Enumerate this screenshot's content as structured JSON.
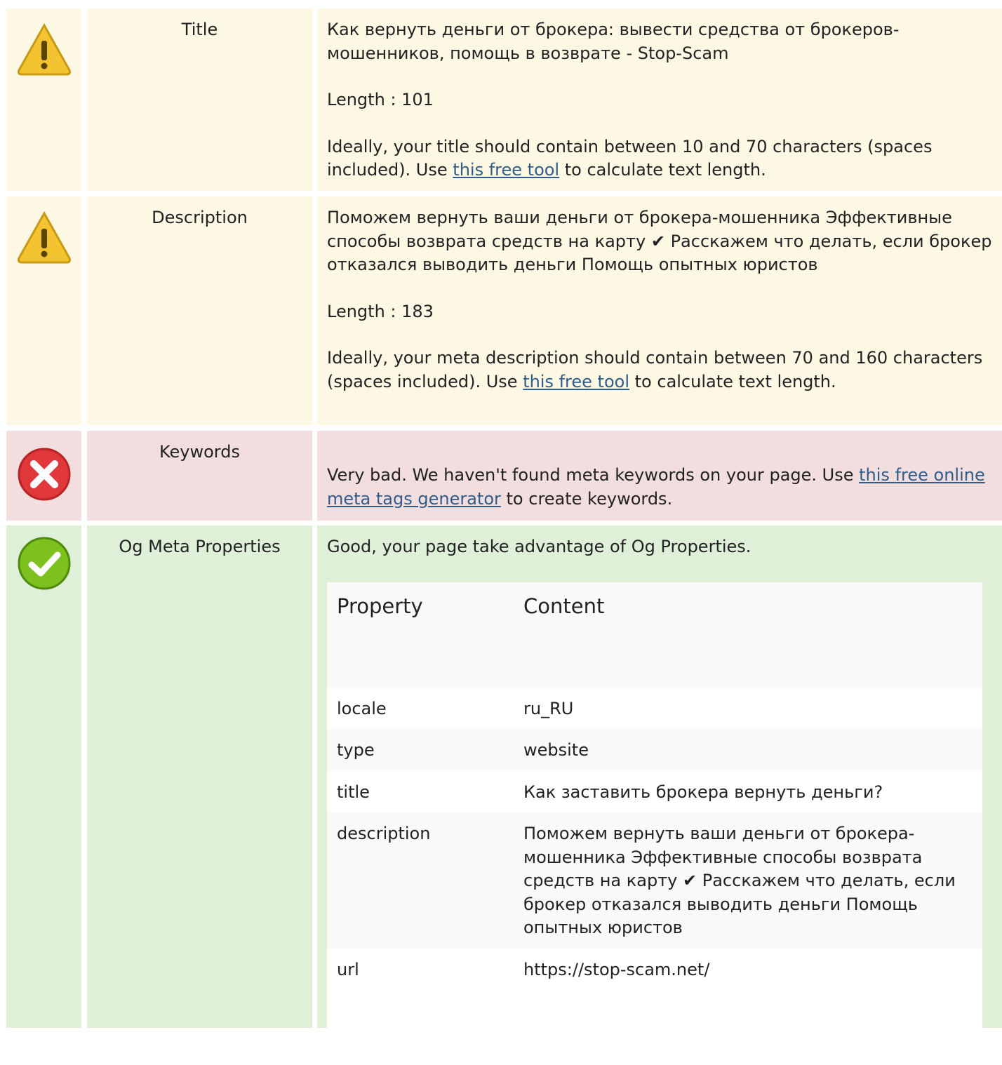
{
  "rows": {
    "title": {
      "label": "Title",
      "status": "warning",
      "text": "Как вернуть деньги от брокера: вывести средства от брокеров-мошенников, помощь в возврате - Stop-Scam",
      "length": "Length : 101",
      "advice_before": "Ideally, your title should contain between 10 and 70 characters (spaces included). Use ",
      "link": "this free tool",
      "advice_after": " to calculate text length."
    },
    "description": {
      "label": "Description",
      "status": "warning",
      "text": "Поможем вернуть ваши деньги от брокера-мошенника  Эффективные способы возврата средств на карту ✔ Расскажем что делать, если брокер отказался выводить деньги  Помощь опытных юристов",
      "length": "Length : 183",
      "advice_before": "Ideally, your meta description should contain between 70 and 160 characters (spaces included). Use ",
      "link": "this free tool",
      "advice_after": " to calculate text length."
    },
    "keywords": {
      "label": "Keywords",
      "status": "error",
      "advice_before": "Very bad. We haven't found meta keywords on your page. Use ",
      "link": "this free online meta tags generator",
      "advice_after": " to create keywords."
    },
    "og": {
      "label": "Og Meta Properties",
      "status": "success",
      "text": "Good, your page take advantage of Og Properties.",
      "table": {
        "headers": [
          "Property",
          "Content"
        ],
        "rows": [
          {
            "property": "locale",
            "content": "ru_RU"
          },
          {
            "property": "type",
            "content": "website"
          },
          {
            "property": "title",
            "content": "Как заставить брокера вернуть деньги?"
          },
          {
            "property": "description",
            "content": "Поможем вернуть ваши деньги от брокера-мошенника  Эффективные способы возврата средств на карту ✔ Расскажем что делать, если брокер отказался выводить деньги  Помощь опытных юристов"
          },
          {
            "property": "url",
            "content": "https://stop-scam.net/"
          }
        ]
      }
    }
  },
  "icons": {
    "warning": "warning-icon",
    "error": "error-icon",
    "success": "success-icon"
  },
  "colors": {
    "warning_bg": "#fdf8e4",
    "error_bg": "#f2dede",
    "success_bg": "#dff0d8",
    "link": "#2f5c8a"
  }
}
